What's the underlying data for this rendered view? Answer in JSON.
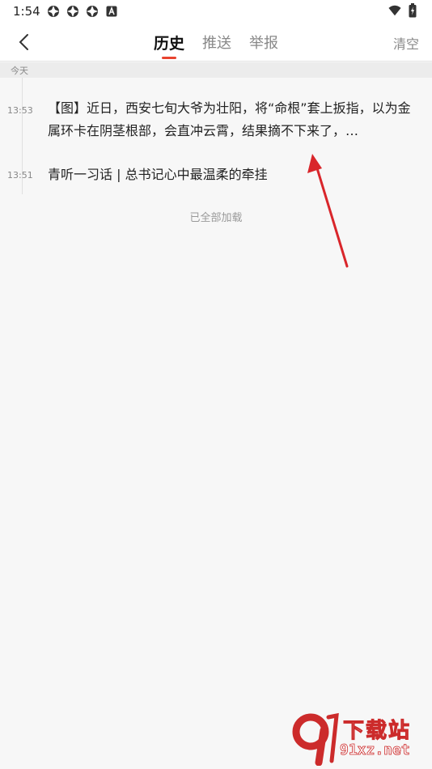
{
  "status_bar": {
    "time": "1:54"
  },
  "header": {
    "tabs": [
      {
        "label": "历史",
        "active": true
      },
      {
        "label": "推送",
        "active": false
      },
      {
        "label": "举报",
        "active": false
      }
    ],
    "clear_label": "清空"
  },
  "section": {
    "label": "今天"
  },
  "history": [
    {
      "time": "13:53",
      "title": "【图】近日，西安七旬大爷为壮阳，将“命根”套上扳指，以为金属环卡在阴茎根部，会直冲云霄，结果摘不下来了，…"
    },
    {
      "time": "13:51",
      "title": "青听一习话 | 总书记心中最温柔的牵挂"
    }
  ],
  "footer": {
    "load_complete": "已全部加载"
  },
  "watermark": {
    "text_top": "下载站",
    "text_bottom": "91xz.net"
  },
  "colors": {
    "accent": "#e8432f",
    "arrow": "#d9262b"
  }
}
